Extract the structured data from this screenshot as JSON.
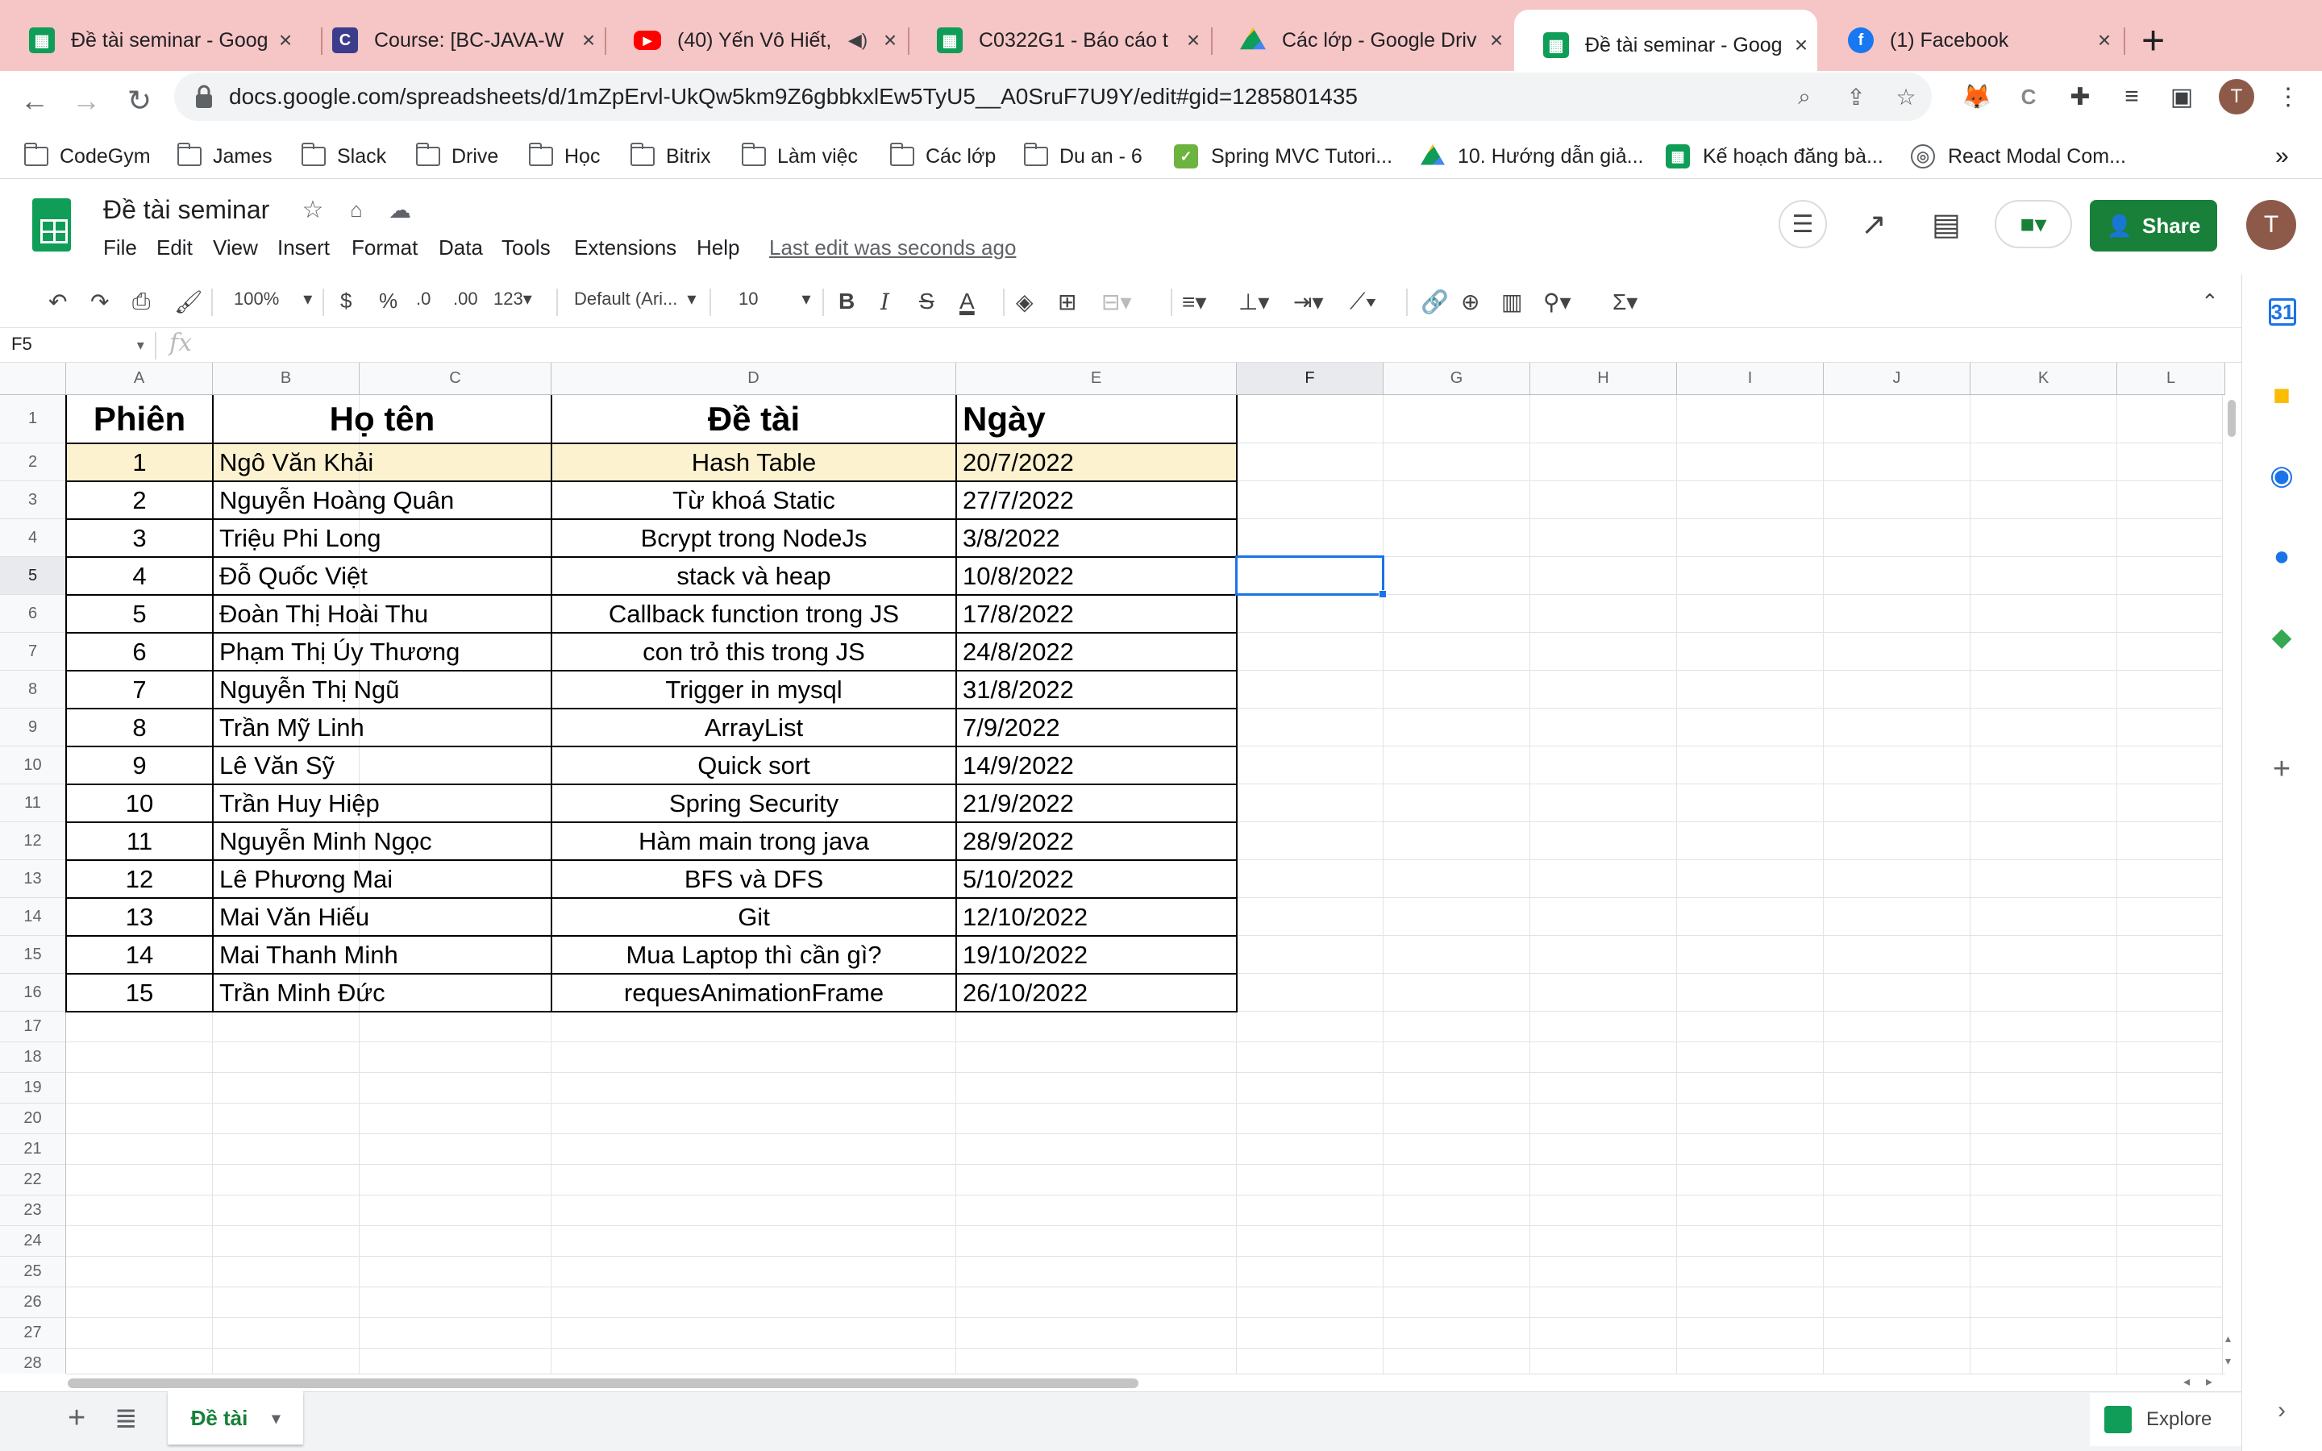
{
  "browser": {
    "tabs": [
      {
        "title": "Đề tài seminar - Goog",
        "icon": "sheets-icon"
      },
      {
        "title": "Course: [BC-JAVA-W",
        "icon": "course-icon"
      },
      {
        "title": "(40) Yến Vô Hiết, ",
        "icon": "youtube-icon"
      },
      {
        "title": "C0322G1 - Báo cáo t",
        "icon": "sheets-icon"
      },
      {
        "title": "Các lớp - Google Driv",
        "icon": "drive-icon"
      },
      {
        "title": "Đề tài seminar - Goog",
        "icon": "sheets-icon",
        "active": true
      },
      {
        "title": "(1) Facebook",
        "icon": "facebook-icon"
      }
    ],
    "new_tab": "+",
    "url": "docs.google.com/spreadsheets/d/1mZpErvl-UkQw5km9Z6gbbkxlEw5TyU5__A0SruF7U9Y/edit#gid=1285801435",
    "profile_initial": "T",
    "bookmarks": [
      {
        "label": "CodeGym",
        "type": "folder"
      },
      {
        "label": "James",
        "type": "folder"
      },
      {
        "label": "Slack",
        "type": "folder"
      },
      {
        "label": "Drive",
        "type": "folder"
      },
      {
        "label": "Học",
        "type": "folder"
      },
      {
        "label": "Bitrix",
        "type": "folder"
      },
      {
        "label": "Làm việc",
        "type": "folder"
      },
      {
        "label": "Các lớp",
        "type": "folder"
      },
      {
        "label": "Du an - 6",
        "type": "folder"
      },
      {
        "label": "Spring MVC Tutori...",
        "type": "link"
      },
      {
        "label": "10. Hướng dẫn giả...",
        "type": "link"
      },
      {
        "label": "Kế hoạch đăng bà...",
        "type": "link"
      },
      {
        "label": "React Modal Com...",
        "type": "link"
      }
    ],
    "bookmarks_more": "»"
  },
  "sheets": {
    "doc_title": "Đề tài seminar",
    "menus": [
      "File",
      "Edit",
      "View",
      "Insert",
      "Format",
      "Data",
      "Tools",
      "Extensions",
      "Help"
    ],
    "last_edit": "Last edit was seconds ago",
    "share_label": "Share",
    "avatar_initial": "T",
    "toolbar": {
      "zoom": "100%",
      "currency": "$",
      "percent": "%",
      "dec_decrease": ".0",
      "dec_increase": ".00",
      "more_formats": "123",
      "font": "Default (Ari...",
      "font_size": "10"
    },
    "name_box": "F5",
    "fx": "fx",
    "formula": "",
    "columns": [
      "A",
      "B",
      "C",
      "D",
      "E",
      "F",
      "G",
      "H",
      "I",
      "J",
      "K",
      "L"
    ],
    "rows": [
      "1",
      "2",
      "3",
      "4",
      "5",
      "6",
      "7",
      "8",
      "9",
      "10",
      "11",
      "12",
      "13",
      "14",
      "15",
      "16",
      "17",
      "18",
      "19",
      "20",
      "21",
      "22",
      "23",
      "24",
      "25",
      "26",
      "27",
      "28"
    ],
    "selected_cell": "F5",
    "headers": [
      "Phiên",
      "Họ tên",
      "Đề tài",
      "Ngày"
    ],
    "data": [
      [
        "1",
        "Ngô Văn Khải",
        "Hash Table",
        "20/7/2022"
      ],
      [
        "2",
        "Nguyễn Hoàng Quân",
        "Từ khoá Static",
        "27/7/2022"
      ],
      [
        "3",
        "Triệu Phi Long",
        "Bcrypt trong NodeJs",
        "3/8/2022"
      ],
      [
        "4",
        "Đỗ Quốc Việt",
        "stack và heap",
        "10/8/2022"
      ],
      [
        "5",
        "Đoàn Thị Hoài Thu",
        "Callback function trong JS",
        "17/8/2022"
      ],
      [
        "6",
        "Phạm Thị Úy Thương",
        "con trỏ this trong JS",
        "24/8/2022"
      ],
      [
        "7",
        "Nguyễn Thị Ngũ",
        "Trigger in mysql",
        "31/8/2022"
      ],
      [
        "8",
        "Trần Mỹ Linh",
        "ArrayList",
        "7/9/2022"
      ],
      [
        "9",
        "Lê Văn Sỹ",
        "Quick sort",
        "14/9/2022"
      ],
      [
        "10",
        "Trần Huy Hiệp",
        "Spring Security",
        "21/9/2022"
      ],
      [
        "11",
        "Nguyễn Minh Ngọc",
        "Hàm main trong java",
        "28/9/2022"
      ],
      [
        "12",
        "Lê Phương Mai",
        "BFS và DFS",
        "5/10/2022"
      ],
      [
        "13",
        "Mai Văn Hiếu",
        "Git",
        "12/10/2022"
      ],
      [
        "14",
        "Mai Thanh Minh",
        "Mua Laptop thì cần gì?",
        "19/10/2022"
      ],
      [
        "15",
        "Trần Minh Đức",
        "requesAnimationFrame",
        "26/10/2022"
      ]
    ],
    "highlight_row_color": "#fcf2d0",
    "sheet_tab": "Đề tài",
    "explore_label": "Explore",
    "accent_color": "#188038"
  }
}
